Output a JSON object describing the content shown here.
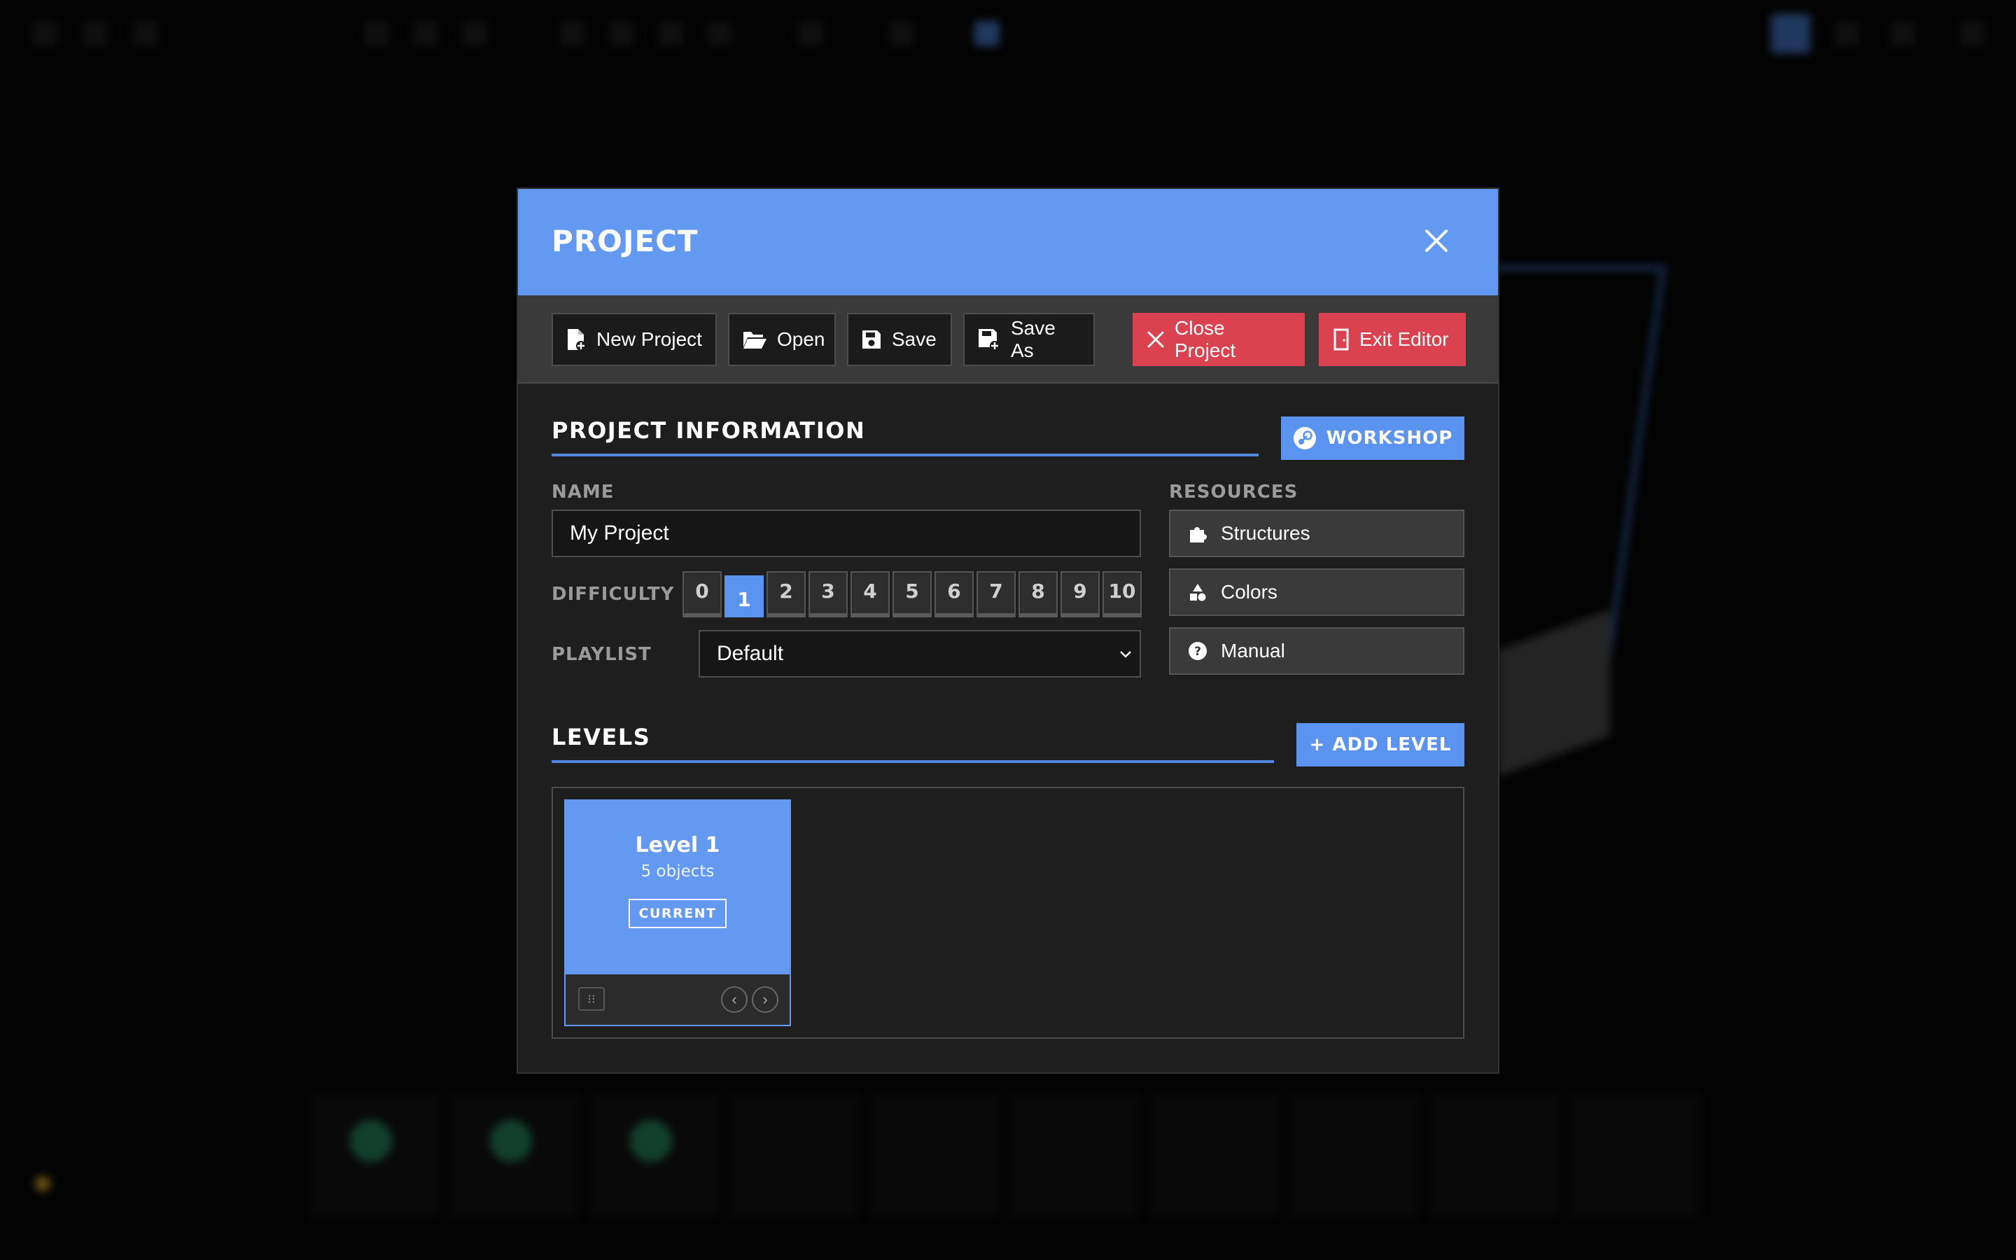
{
  "modal": {
    "title": "PROJECT",
    "close_icon": "close-icon"
  },
  "toolbar": {
    "new_project": "New Project",
    "open": "Open",
    "save": "Save",
    "save_as": "Save As",
    "close_project": "Close Project",
    "exit_editor": "Exit Editor"
  },
  "project_info": {
    "heading": "PROJECT INFORMATION",
    "workshop_label": "WORKSHOP",
    "name_label": "NAME",
    "name_value": "My Project",
    "difficulty_label": "DIFFICULTY",
    "difficulty_options": [
      "0",
      "1",
      "2",
      "3",
      "4",
      "5",
      "6",
      "7",
      "8",
      "9",
      "10"
    ],
    "difficulty_selected": "1",
    "playlist_label": "PLAYLIST",
    "playlist_value": "Default"
  },
  "resources": {
    "label": "RESOURCES",
    "items": [
      {
        "label": "Structures",
        "icon": "puzzle-icon"
      },
      {
        "label": "Colors",
        "icon": "shapes-icon"
      },
      {
        "label": "Manual",
        "icon": "help-icon"
      }
    ]
  },
  "levels": {
    "heading": "LEVELS",
    "add_label": "+ ADD LEVEL",
    "items": [
      {
        "name": "Level 1",
        "count": "5 objects",
        "badge": "CURRENT"
      }
    ]
  },
  "colors": {
    "accent": "#6399f0",
    "danger": "#d9424e",
    "panel": "#1e1e1e"
  }
}
